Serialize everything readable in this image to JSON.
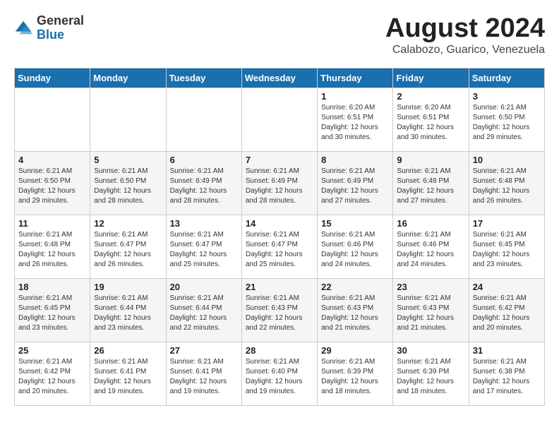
{
  "logo": {
    "general": "General",
    "blue": "Blue"
  },
  "title": "August 2024",
  "subtitle": "Calabozo, Guarico, Venezuela",
  "headers": [
    "Sunday",
    "Monday",
    "Tuesday",
    "Wednesday",
    "Thursday",
    "Friday",
    "Saturday"
  ],
  "weeks": [
    [
      {
        "day": "",
        "info": ""
      },
      {
        "day": "",
        "info": ""
      },
      {
        "day": "",
        "info": ""
      },
      {
        "day": "",
        "info": ""
      },
      {
        "day": "1",
        "info": "Sunrise: 6:20 AM\nSunset: 6:51 PM\nDaylight: 12 hours\nand 30 minutes."
      },
      {
        "day": "2",
        "info": "Sunrise: 6:20 AM\nSunset: 6:51 PM\nDaylight: 12 hours\nand 30 minutes."
      },
      {
        "day": "3",
        "info": "Sunrise: 6:21 AM\nSunset: 6:50 PM\nDaylight: 12 hours\nand 29 minutes."
      }
    ],
    [
      {
        "day": "4",
        "info": "Sunrise: 6:21 AM\nSunset: 6:50 PM\nDaylight: 12 hours\nand 29 minutes."
      },
      {
        "day": "5",
        "info": "Sunrise: 6:21 AM\nSunset: 6:50 PM\nDaylight: 12 hours\nand 28 minutes."
      },
      {
        "day": "6",
        "info": "Sunrise: 6:21 AM\nSunset: 6:49 PM\nDaylight: 12 hours\nand 28 minutes."
      },
      {
        "day": "7",
        "info": "Sunrise: 6:21 AM\nSunset: 6:49 PM\nDaylight: 12 hours\nand 28 minutes."
      },
      {
        "day": "8",
        "info": "Sunrise: 6:21 AM\nSunset: 6:49 PM\nDaylight: 12 hours\nand 27 minutes."
      },
      {
        "day": "9",
        "info": "Sunrise: 6:21 AM\nSunset: 6:48 PM\nDaylight: 12 hours\nand 27 minutes."
      },
      {
        "day": "10",
        "info": "Sunrise: 6:21 AM\nSunset: 6:48 PM\nDaylight: 12 hours\nand 26 minutes."
      }
    ],
    [
      {
        "day": "11",
        "info": "Sunrise: 6:21 AM\nSunset: 6:48 PM\nDaylight: 12 hours\nand 26 minutes."
      },
      {
        "day": "12",
        "info": "Sunrise: 6:21 AM\nSunset: 6:47 PM\nDaylight: 12 hours\nand 26 minutes."
      },
      {
        "day": "13",
        "info": "Sunrise: 6:21 AM\nSunset: 6:47 PM\nDaylight: 12 hours\nand 25 minutes."
      },
      {
        "day": "14",
        "info": "Sunrise: 6:21 AM\nSunset: 6:47 PM\nDaylight: 12 hours\nand 25 minutes."
      },
      {
        "day": "15",
        "info": "Sunrise: 6:21 AM\nSunset: 6:46 PM\nDaylight: 12 hours\nand 24 minutes."
      },
      {
        "day": "16",
        "info": "Sunrise: 6:21 AM\nSunset: 6:46 PM\nDaylight: 12 hours\nand 24 minutes."
      },
      {
        "day": "17",
        "info": "Sunrise: 6:21 AM\nSunset: 6:45 PM\nDaylight: 12 hours\nand 23 minutes."
      }
    ],
    [
      {
        "day": "18",
        "info": "Sunrise: 6:21 AM\nSunset: 6:45 PM\nDaylight: 12 hours\nand 23 minutes."
      },
      {
        "day": "19",
        "info": "Sunrise: 6:21 AM\nSunset: 6:44 PM\nDaylight: 12 hours\nand 23 minutes."
      },
      {
        "day": "20",
        "info": "Sunrise: 6:21 AM\nSunset: 6:44 PM\nDaylight: 12 hours\nand 22 minutes."
      },
      {
        "day": "21",
        "info": "Sunrise: 6:21 AM\nSunset: 6:43 PM\nDaylight: 12 hours\nand 22 minutes."
      },
      {
        "day": "22",
        "info": "Sunrise: 6:21 AM\nSunset: 6:43 PM\nDaylight: 12 hours\nand 21 minutes."
      },
      {
        "day": "23",
        "info": "Sunrise: 6:21 AM\nSunset: 6:43 PM\nDaylight: 12 hours\nand 21 minutes."
      },
      {
        "day": "24",
        "info": "Sunrise: 6:21 AM\nSunset: 6:42 PM\nDaylight: 12 hours\nand 20 minutes."
      }
    ],
    [
      {
        "day": "25",
        "info": "Sunrise: 6:21 AM\nSunset: 6:42 PM\nDaylight: 12 hours\nand 20 minutes."
      },
      {
        "day": "26",
        "info": "Sunrise: 6:21 AM\nSunset: 6:41 PM\nDaylight: 12 hours\nand 19 minutes."
      },
      {
        "day": "27",
        "info": "Sunrise: 6:21 AM\nSunset: 6:41 PM\nDaylight: 12 hours\nand 19 minutes."
      },
      {
        "day": "28",
        "info": "Sunrise: 6:21 AM\nSunset: 6:40 PM\nDaylight: 12 hours\nand 19 minutes."
      },
      {
        "day": "29",
        "info": "Sunrise: 6:21 AM\nSunset: 6:39 PM\nDaylight: 12 hours\nand 18 minutes."
      },
      {
        "day": "30",
        "info": "Sunrise: 6:21 AM\nSunset: 6:39 PM\nDaylight: 12 hours\nand 18 minutes."
      },
      {
        "day": "31",
        "info": "Sunrise: 6:21 AM\nSunset: 6:38 PM\nDaylight: 12 hours\nand 17 minutes."
      }
    ]
  ]
}
